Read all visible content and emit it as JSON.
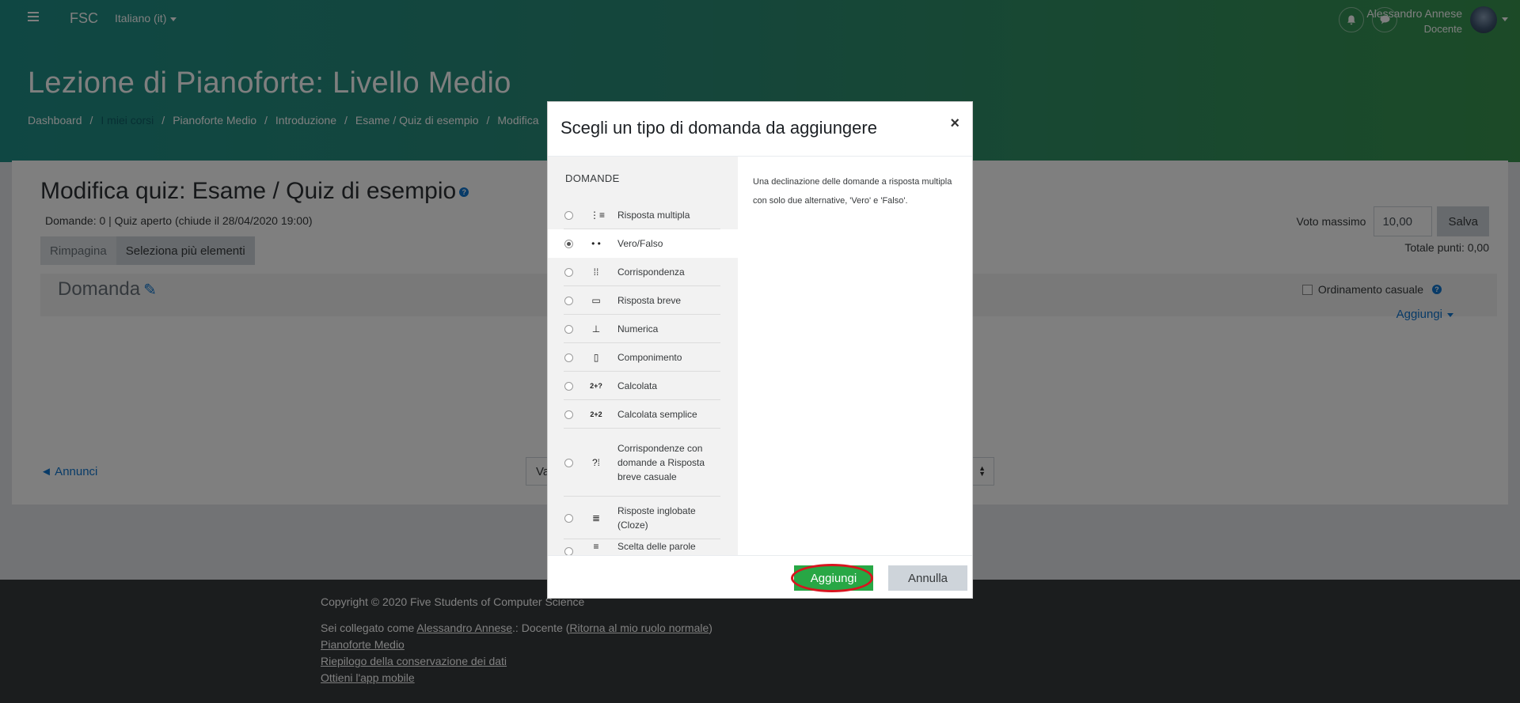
{
  "header": {
    "brand": "FSC",
    "language": "Italiano (it)",
    "user_name": "Alessandro Annese",
    "user_role": "Docente",
    "course_title": "Lezione di Pianoforte: Livello Medio",
    "breadcrumb": [
      "Dashboard",
      "I miei corsi",
      "Pianoforte Medio",
      "Introduzione",
      "Esame / Quiz di esempio",
      "Modifica"
    ],
    "colors": {
      "gradient_start": "#1f8f87",
      "gradient_end": "#38954f"
    }
  },
  "main": {
    "title": "Modifica quiz: Esame / Quiz di esempio",
    "quiz_info": "Domande: 0 | Quiz aperto (chiude il 28/04/2020 19:00)",
    "repaginate_label": "Rimpagina",
    "select_multiple_label": "Seleziona più elementi",
    "max_grade_label": "Voto massimo",
    "max_grade_value": "10,00",
    "save_label": "Salva",
    "total_points": "Totale punti: 0,00",
    "section_title": "Domanda",
    "shuffle_label": "Ordinamento casuale",
    "add_label": "Aggiungi",
    "prev_link": "◄ Annunci",
    "jump_select": "Va"
  },
  "modal": {
    "title": "Scegli un tipo di domanda da aggiungere",
    "close": "×",
    "section_heading": "DOMANDE",
    "options": [
      {
        "label": "Risposta multipla",
        "icon": "list-icon",
        "glyph": "⋮≡",
        "checked": false
      },
      {
        "label": "Vero/Falso",
        "icon": "dots-icon",
        "glyph": "• •",
        "checked": true
      },
      {
        "label": "Corrispondenza",
        "icon": "match-icon",
        "glyph": "⁞⁞",
        "checked": false
      },
      {
        "label": "Risposta breve",
        "icon": "textbox-icon",
        "glyph": "▭",
        "checked": false
      },
      {
        "label": "Numerica",
        "icon": "numeric-icon",
        "glyph": "⊥",
        "checked": false
      },
      {
        "label": "Componimento",
        "icon": "essay-icon",
        "glyph": "▯",
        "checked": false
      },
      {
        "label": "Calcolata",
        "icon": "calculated-icon",
        "glyph": "2+?",
        "checked": false
      },
      {
        "label": "Calcolata semplice",
        "icon": "calculated-simple-icon",
        "glyph": "2+2",
        "checked": false
      },
      {
        "label": "Corrispondenze con domande a Risposta breve casuale",
        "icon": "random-match-icon",
        "glyph": "?⁞",
        "checked": false
      },
      {
        "label": "Risposte inglobate (Cloze)",
        "icon": "cloze-icon",
        "glyph": "≣",
        "checked": false
      },
      {
        "label": "Scelta delle parole",
        "icon": "word-select-icon",
        "glyph": "≡",
        "checked": false
      }
    ],
    "description": "Una declinazione delle domande a risposta multipla con solo due alternative, 'Vero' e 'Falso'.",
    "add_button": "Aggiungi",
    "cancel_button": "Annulla"
  },
  "footer": {
    "copyright": "Copyright © 2020 Five Students of Computer Science",
    "logged_in_prefix": "Sei collegato come ",
    "logged_in_user": "Alessandro Annese",
    "logged_in_role": ".: Docente (",
    "return_role": "Ritorna al mio ruolo normale",
    "logged_in_suffix": ")",
    "course_link": "Pianoforte Medio",
    "data_retention": "Riepilogo della conservazione dei dati",
    "mobile_app": "Ottieni l'app mobile"
  }
}
